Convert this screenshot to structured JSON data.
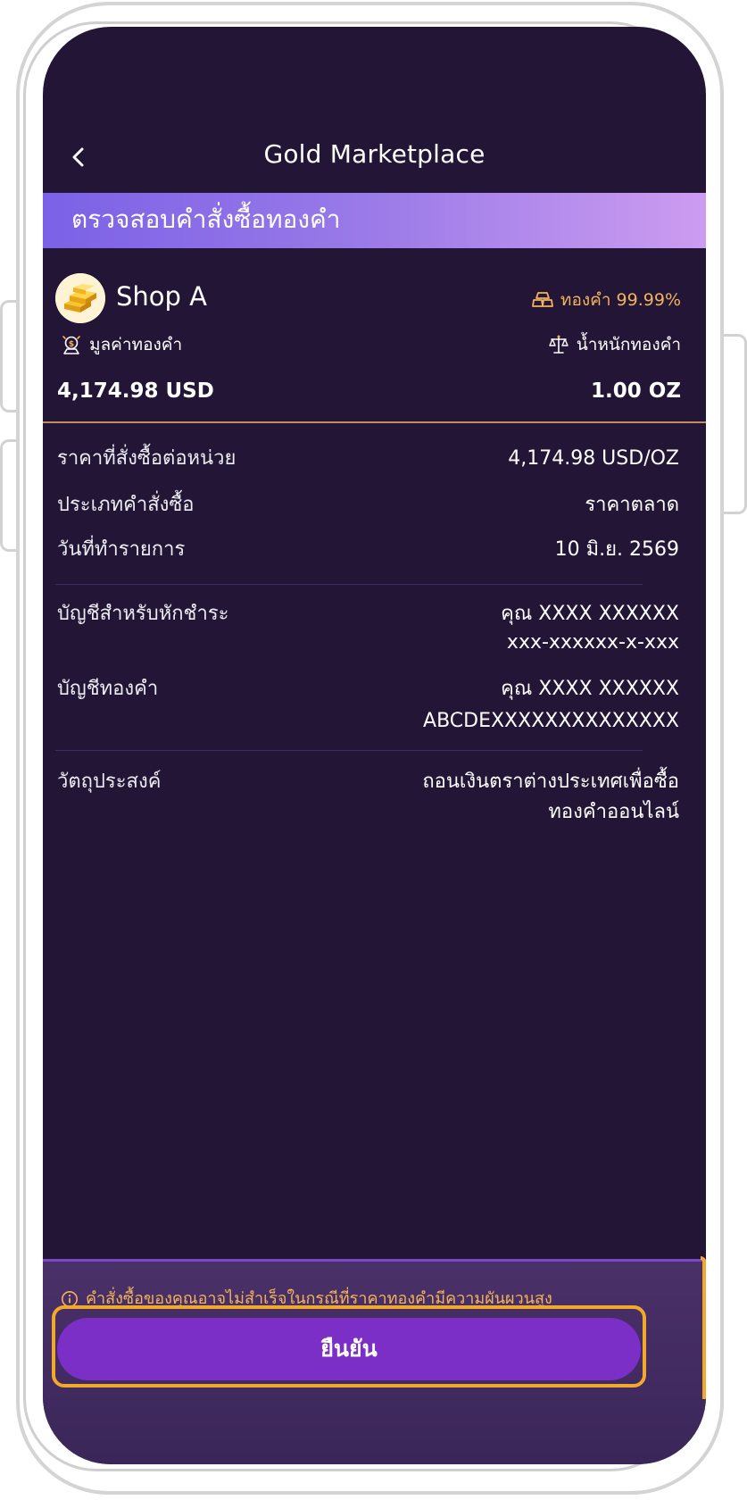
{
  "header": {
    "title": "Gold Marketplace"
  },
  "banner": {
    "title": "ตรวจสอบคำสั่งซื้อทองคำ"
  },
  "shop": {
    "name": "Shop A",
    "purity": "ทองคำ 99.99%",
    "value_label": "มูลค่าทองคำ",
    "value": "4,174.98 USD",
    "weight_label": "น้ำหนักทองคำ",
    "weight": "1.00 OZ"
  },
  "details": {
    "unit_price_label": "ราคาที่สั่งซื้อต่อหน่วย",
    "unit_price": "4,174.98 USD/OZ",
    "order_type_label": "ประเภทคำสั่งซื้อ",
    "order_type": "ราคาตลาด",
    "date_label": "วันที่ทำรายการ",
    "date": "10 มิ.ย. 2569",
    "debit_account_label": "บัญชีสำหรับหักชำระ",
    "debit_account_name": "คุณ XXXX XXXXXX",
    "debit_account_number": "xxx-xxxxxx-x-xxx",
    "gold_account_label": "บัญชีทองคำ",
    "gold_account_name": "คุณ XXXX XXXXXX",
    "gold_account_number": "ABCDEXXXXXXXXXXXXXX",
    "purpose_label": "วัตถุประสงค์",
    "purpose_line1": "ถอนเงินตราต่างประเทศเพื่อซื้อ",
    "purpose_line2": "ทองคำออนไลน์"
  },
  "footer": {
    "warning": "คำสั่งซื้อของคุณอาจไม่สำเร็จในกรณีที่ราคาทองคำมีความผันผวนสูง",
    "confirm_label": "ยืนยัน"
  },
  "colors": {
    "background": "#221536",
    "accent_gold": "#f2b45a",
    "button": "#7b2fc6",
    "highlight": "#f2a929"
  }
}
